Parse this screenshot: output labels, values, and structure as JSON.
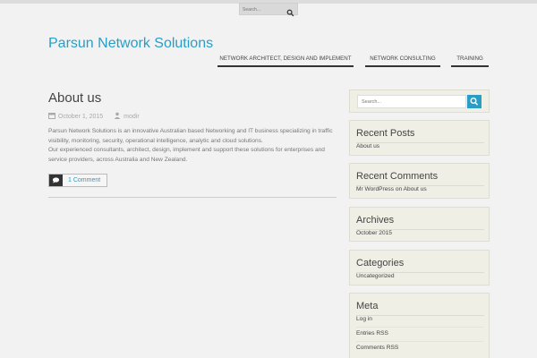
{
  "top": {
    "search_placeholder": "Search..."
  },
  "site": {
    "title": "Parsun Network Solutions"
  },
  "nav": {
    "items": [
      {
        "label": "NETWORK ARCHITECT, DESIGN AND IMPLEMENT"
      },
      {
        "label": "NETWORK CONSULTING"
      },
      {
        "label": "TRAINING"
      }
    ]
  },
  "post": {
    "title": "About us",
    "date": "October 1, 2015",
    "author": "modir",
    "paragraph1": "Parsun Network Solutions is an innovative Australian based Networking and IT business specializing in traffic visibility, monitoring, security, operational intelligence, analytic and cloud solutions.",
    "paragraph2": "Our experienced consultants, architect, design, implement and support these solutions for enterprises and service providers, across Australia and New Zealand.",
    "comments_label": "1 Comment"
  },
  "sidebar": {
    "search_placeholder": "Search...",
    "recent_posts": {
      "title": "Recent Posts",
      "items": [
        "About us"
      ]
    },
    "recent_comments": {
      "title": "Recent Comments",
      "items": [
        "Mr WordPress on About us"
      ]
    },
    "archives": {
      "title": "Archives",
      "items": [
        "October 2015"
      ]
    },
    "categories": {
      "title": "Categories",
      "items": [
        "Uncategorized"
      ]
    },
    "meta": {
      "title": "Meta",
      "items": [
        "Log in",
        "Entries RSS",
        "Comments RSS"
      ]
    }
  },
  "colors": {
    "accent": "#2a9dc5",
    "background": "#f2f2f2",
    "widget_bg": "#efefe6"
  },
  "icons": {
    "search": "search-icon",
    "calendar": "calendar-icon",
    "user": "user-icon",
    "comment": "comment-icon"
  }
}
